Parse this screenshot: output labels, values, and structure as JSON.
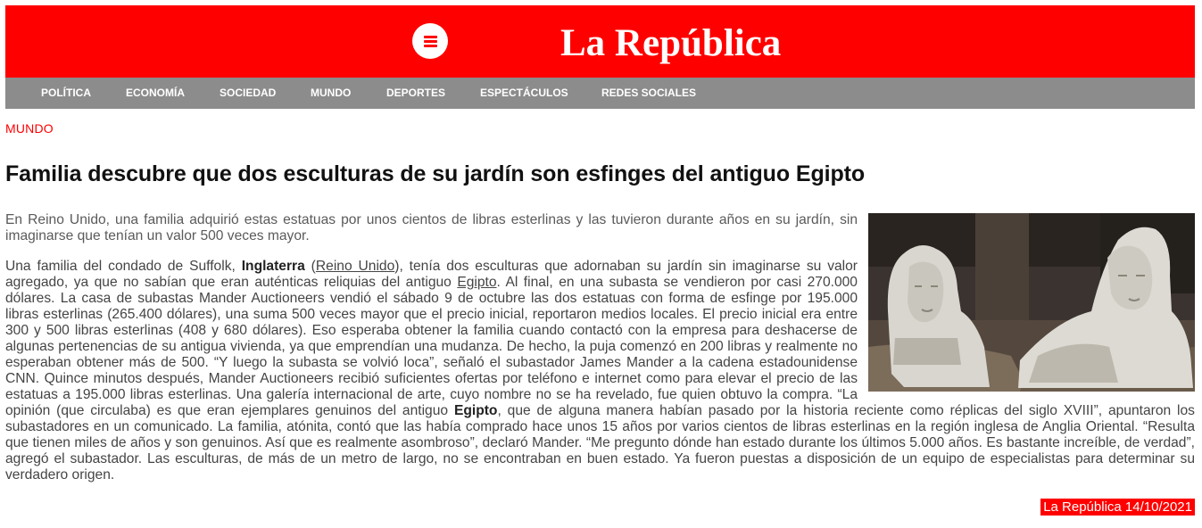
{
  "header": {
    "site_title": "La República",
    "menu_icon": "hamburger-menu-icon",
    "brand_color": "#ff0000"
  },
  "nav": {
    "items": [
      {
        "label": "POLÍTICA"
      },
      {
        "label": "ECONOMÍA"
      },
      {
        "label": "SOCIEDAD"
      },
      {
        "label": "MUNDO"
      },
      {
        "label": "DEPORTES"
      },
      {
        "label": "ESPECTÁCULOS"
      },
      {
        "label": "REDES SOCIALES"
      }
    ],
    "bar_color": "#8c8c8c"
  },
  "article": {
    "section": "MUNDO",
    "headline": "Familia descubre que dos esculturas de su jardín son esfinges del antiguo Egipto",
    "lead": "En Reino Unido, una familia adquirió estas estatuas por unos cientos de libras esterlinas y las tuvieron durante años en su jardín, sin imaginarse que tenían un valor 500 veces mayor.",
    "body": {
      "p1": "Una familia del condado de Suffolk, ",
      "bold_inglaterra": "Inglaterra",
      "p2": " (",
      "link_reino_unido": "Reino Unido",
      "p3": "), tenía dos esculturas que adornaban su jardín sin imaginarse su valor agregado, ya que no sabían que eran auténticas reliquias del antiguo ",
      "link_egipto": "Egipto",
      "p4": ". Al final, en una subasta se vendieron por casi 270.000 dólares. La casa de subastas Mander Auctioneers vendió el sábado 9 de octubre las dos estatuas con forma de esfinge por 195.000 libras esterlinas (265.400 dólares), una suma 500 veces mayor que el precio inicial, reportaron medios locales. El precio inicial era entre 300 y 500 libras esterlinas (408 y 680 dólares). Eso esperaba obtener la familia cuando contactó con la empresa para deshacerse de algunas pertenencias de su antigua vivienda, ya que emprendían una mudanza. De hecho, la puja comenzó en 200 libras y realmente no esperaban obtener más de 500. “Y luego la subasta se volvió loca”, señaló el subastador James Mander a la cadena estadounidense CNN. Quince minutos después, Mander Auctioneers recibió suficientes ofertas por teléfono e internet como para elevar el precio de las estatuas a 195.000 libras esterlinas. Una galería internacional de arte, cuyo nombre no se ha revelado, fue quien obtuvo la compra. “La opinión (que circulaba) es que eran ejemplares genuinos del antiguo ",
      "bold_egipto": "Egipto",
      "p5": ", que de alguna manera habían pasado por la historia reciente como réplicas del siglo XVIII”, apuntaron los subastadores en un comunicado. La familia, atónita, contó que las había comprado hace unos 15 años por varios cientos de libras esterlinas en la región inglesa de Anglia Oriental. “Resulta que tienen miles de años y son genuinos. Así que es realmente asombroso”, declaró Mander. “Me pregunto dónde han estado durante los últimos 5.000 años. Es bastante increíble, de verdad”, agregó el subastador. Las esculturas, de más de un metro de largo, no se encontraban en buen estado. Ya fueron puestas a disposición de un equipo de especialistas para determinar su verdadero origen."
    },
    "dateline": "La República 14/10/2021"
  }
}
